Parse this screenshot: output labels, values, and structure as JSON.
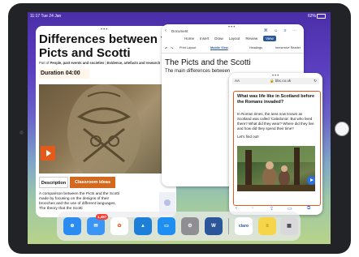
{
  "status": {
    "time": "11:17",
    "date": "Tue 24 Jan",
    "battery": "62%"
  },
  "lesson": {
    "title": "Differences between the Picts and Scotti",
    "part_of_prefix": "Part of",
    "part_of": "People, past events and societies",
    "part_of_rest": "Evidence, artefacts and research",
    "duration": "Duration 04:00",
    "tab_description": "Description",
    "tab_classroom": "Classroom ideas",
    "description": "A comparison between the Picts and the Scotti made by focusing on the designs of their brooches and the use of different languages. The theory that the Scotti"
  },
  "word": {
    "doc_label": "Document",
    "ribbon": [
      "Home",
      "Insert",
      "Draw",
      "Layout",
      "Review",
      "View"
    ],
    "active_ribbon": "View",
    "toolbar": [
      "Print Layout",
      "Mobile View",
      "Headings",
      "Immersive Reader"
    ],
    "doc_title": "The Picts and the Scotti",
    "doc_sub": "The main differences between"
  },
  "safari": {
    "aa": "AA",
    "url": "bbc.co.uk",
    "question": "What was life like in Scotland before the Romans invaded?",
    "para1": "In Roman times, the area now known as Scotland was called 'Caledonia'. But who lived there? What did they wear? Where did they live and how did they spend their time?",
    "para2": "Let's find out!"
  },
  "dock": {
    "mail_badge": "1,487",
    "word_label": "W",
    "claro_label": "claro"
  },
  "colors": {
    "accent": "#e35a1a",
    "word_blue": "#2b579a",
    "safari_blue": "#2e6fe0"
  }
}
